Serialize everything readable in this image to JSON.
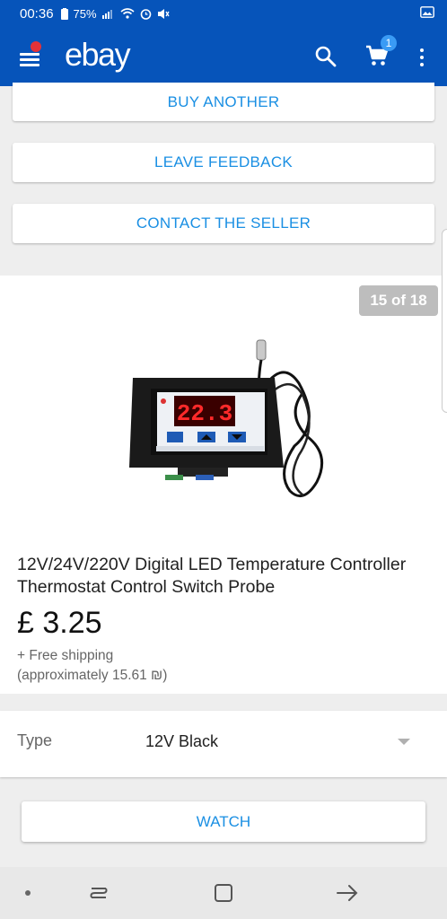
{
  "status_bar": {
    "time": "00:36",
    "battery": "75%"
  },
  "app_bar": {
    "logo": "ebay",
    "cart_count": "1"
  },
  "actions": {
    "buy_another": "BUY ANOTHER",
    "leave_feedback": "LEAVE FEEDBACK",
    "contact_seller": "CONTACT THE SELLER"
  },
  "product": {
    "image_counter": "15 of 18",
    "title": "12V/24V/220V Digital LED Temperature Controller Thermostat Control Switch Probe",
    "price": "£ 3.25",
    "shipping": "+ Free shipping",
    "approx_price": "(approximately 15.61 ₪)",
    "device_display": "22.3"
  },
  "variation": {
    "label": "Type",
    "value": "12V Black"
  },
  "watch": {
    "label": "WATCH"
  },
  "colors": {
    "brand_blue": "#0654ba",
    "link_blue": "#1a8fe3",
    "notification_red": "#e53238"
  }
}
